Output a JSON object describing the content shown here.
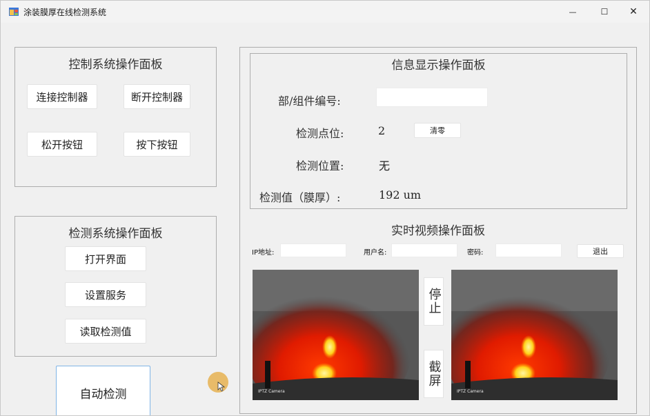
{
  "window": {
    "title": "涂装膜厚在线检测系统",
    "minimize_glyph": "—",
    "maximize_glyph": "☐",
    "close_glyph": "✕"
  },
  "control_panel": {
    "title": "控制系统操作面板",
    "connect_label": "连接控制器",
    "disconnect_label": "断开控制器",
    "release_label": "松开按钮",
    "press_label": "按下按钮"
  },
  "detect_panel": {
    "title": "检测系统操作面板",
    "open_ui_label": "打开界面",
    "settings_label": "设置服务",
    "read_value_label": "读取检测值"
  },
  "auto_detect_label": "自动检测",
  "info_panel": {
    "title": "信息显示操作面板",
    "part_number_label": "部/组件编号:",
    "part_number_value": "",
    "point_label": "检测点位:",
    "point_value": "2",
    "clear_label": "清零",
    "position_label": "检测位置:",
    "position_value": "无",
    "thickness_label": "检测值（膜厚）:",
    "thickness_value": "192 um"
  },
  "video_panel": {
    "title": "实时视频操作面板",
    "ip_label": "IP地址:",
    "user_label": "用户名:",
    "password_label": "密码:",
    "exit_label": "退出",
    "stop_label": "停止",
    "capture_label": "截屏",
    "camera_caption": "IPTZ Camera"
  },
  "colors": {
    "window_bg": "#f0f0f0",
    "border": "#adadad",
    "flame_core": "#ff2a00",
    "flame_bright": "#ffd21a"
  },
  "icons": {
    "app": "app-window-icon",
    "minimize": "minimize-icon",
    "maximize": "maximize-icon",
    "close": "close-icon",
    "cursor": "mouse-cursor-icon"
  }
}
